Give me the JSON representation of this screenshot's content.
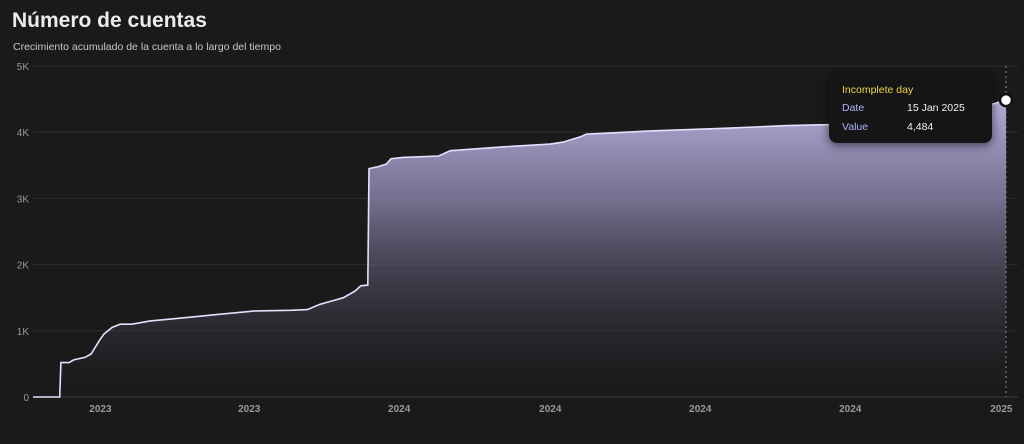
{
  "header": {
    "title": "Número de cuentas",
    "subtitle": "Crecimiento acumulado de la cuenta a lo largo del tiempo"
  },
  "tooltip": {
    "title": "Incomplete day",
    "date_label": "Date",
    "date_value": "15 Jan 2025",
    "value_label": "Value",
    "value_value": "4,484"
  },
  "colors": {
    "line": "#e6e0ff",
    "fill_top": "#b6aedb",
    "background": "#1a1a1b",
    "grid": "#2e2e30",
    "tooltip_title": "#f2d544"
  },
  "chart_data": {
    "type": "area",
    "title": "Número de cuentas",
    "subtitle": "Crecimiento acumulado de la cuenta a lo largo del tiempo",
    "xlabel": "",
    "ylabel": "",
    "ylim": [
      0,
      5000
    ],
    "xlim": [
      "2022-10-01",
      "2025-01-15"
    ],
    "y_ticks": [
      {
        "value": 0,
        "label": "0"
      },
      {
        "value": 1000,
        "label": "1K"
      },
      {
        "value": 2000,
        "label": "2K"
      },
      {
        "value": 3000,
        "label": "3K"
      },
      {
        "value": 4000,
        "label": "4K"
      },
      {
        "value": 5000,
        "label": "5K"
      }
    ],
    "x_ticks": [
      {
        "value": "2022-11-28",
        "label": "2023"
      },
      {
        "value": "2023-04-05",
        "label": "2023"
      },
      {
        "value": "2023-08-12",
        "label": "2024"
      },
      {
        "value": "2023-12-20",
        "label": "2024"
      },
      {
        "value": "2024-04-27",
        "label": "2024"
      },
      {
        "value": "2024-09-03",
        "label": "2024"
      },
      {
        "value": "2025-01-11",
        "label": "2025"
      }
    ],
    "grid": true,
    "legend": "none",
    "series": [
      {
        "x": [
          "2022-10-01",
          "2022-10-24",
          "2022-10-25",
          "2022-11-01",
          "2022-11-05",
          "2022-11-15",
          "2022-11-20",
          "2022-11-27",
          "2022-12-01",
          "2022-12-08",
          "2022-12-15",
          "2022-12-25",
          "2023-01-10",
          "2023-02-10",
          "2023-03-10",
          "2023-04-10",
          "2023-05-10",
          "2023-05-25",
          "2023-06-05",
          "2023-06-15",
          "2023-06-25",
          "2023-07-05",
          "2023-07-10",
          "2023-07-16",
          "2023-07-17",
          "2023-07-25",
          "2023-08-01",
          "2023-08-05",
          "2023-08-15",
          "2023-09-15",
          "2023-09-25",
          "2023-10-10",
          "2023-11-10",
          "2023-12-20",
          "2023-12-31",
          "2024-01-15",
          "2024-01-20",
          "2024-03-15",
          "2024-05-20",
          "2024-07-10",
          "2024-08-30",
          "2024-09-20",
          "2024-10-20",
          "2024-12-10",
          "2025-01-15"
        ],
        "y": [
          0,
          0,
          520,
          520,
          560,
          600,
          650,
          850,
          950,
          1050,
          1100,
          1100,
          1150,
          1200,
          1250,
          1300,
          1310,
          1320,
          1400,
          1450,
          1500,
          1600,
          1680,
          1690,
          3450,
          3480,
          3520,
          3600,
          3620,
          3640,
          3720,
          3740,
          3780,
          3820,
          3850,
          3930,
          3970,
          4020,
          4060,
          4100,
          4120,
          4150,
          4210,
          4300,
          4484
        ]
      }
    ]
  }
}
